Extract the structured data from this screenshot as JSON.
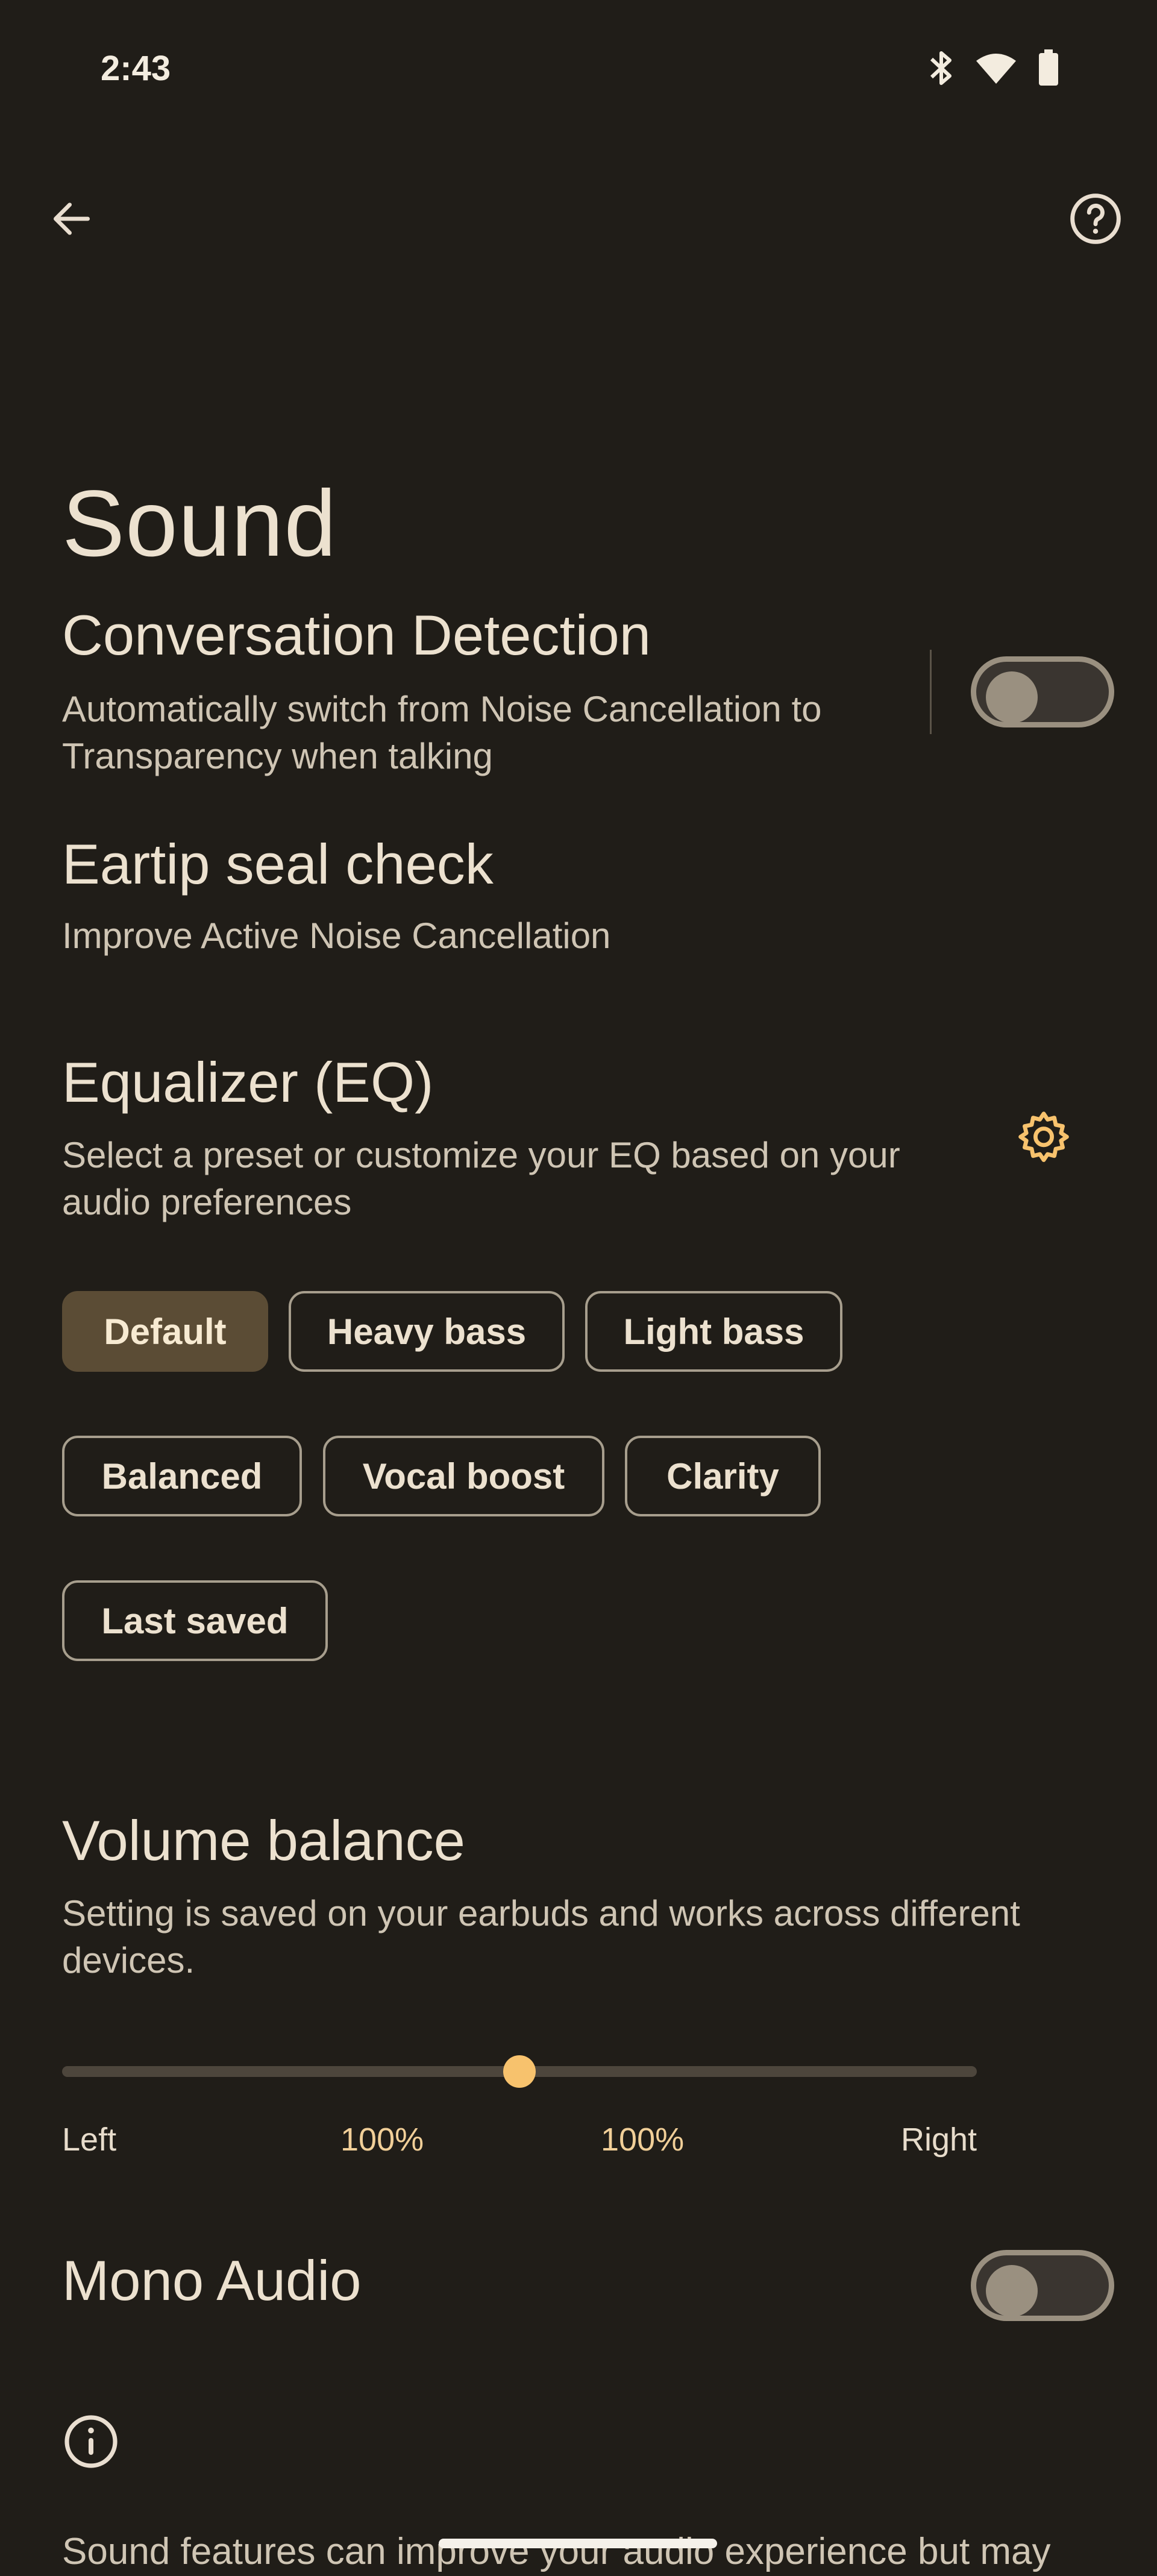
{
  "status_bar": {
    "time": "2:43",
    "icons": [
      "bluetooth-icon",
      "wifi-icon",
      "battery-icon"
    ]
  },
  "app_bar": {
    "back_icon": "arrow-back-icon",
    "help_icon": "help-circle-icon"
  },
  "page": {
    "title": "Sound"
  },
  "conversation_detection": {
    "title": "Conversation Detection",
    "description_line1": "Automatically switch from Noise Cancellation to",
    "description_line2": "Transparency when talking",
    "enabled": false
  },
  "eartip_seal_check": {
    "title": "Eartip seal check",
    "description": "Improve Active Noise Cancellation"
  },
  "equalizer": {
    "title": "Equalizer (EQ)",
    "description_line1": "Select a preset or customize your EQ based on your",
    "description_line2": "audio preferences",
    "settings_icon": "gear-icon",
    "presets": [
      "Default",
      "Heavy bass",
      "Light bass",
      "Balanced",
      "Vocal boost",
      "Clarity",
      "Last saved"
    ],
    "selected": "Default"
  },
  "volume_balance": {
    "title": "Volume balance",
    "description_line1": "Setting is saved on your earbuds and works across different",
    "description_line2": "devices.",
    "left_label": "Left",
    "right_label": "Right",
    "left_value": "100%",
    "right_value": "100%",
    "balance_fraction": 0.5
  },
  "mono_audio": {
    "title": "Mono Audio",
    "enabled": false
  },
  "info": {
    "icon": "info-icon",
    "text": "Sound features can improve your audio experience but may"
  },
  "colors": {
    "background": "#201d18",
    "accent": "#f7c26d",
    "selected_chip": "#5b4c35"
  }
}
